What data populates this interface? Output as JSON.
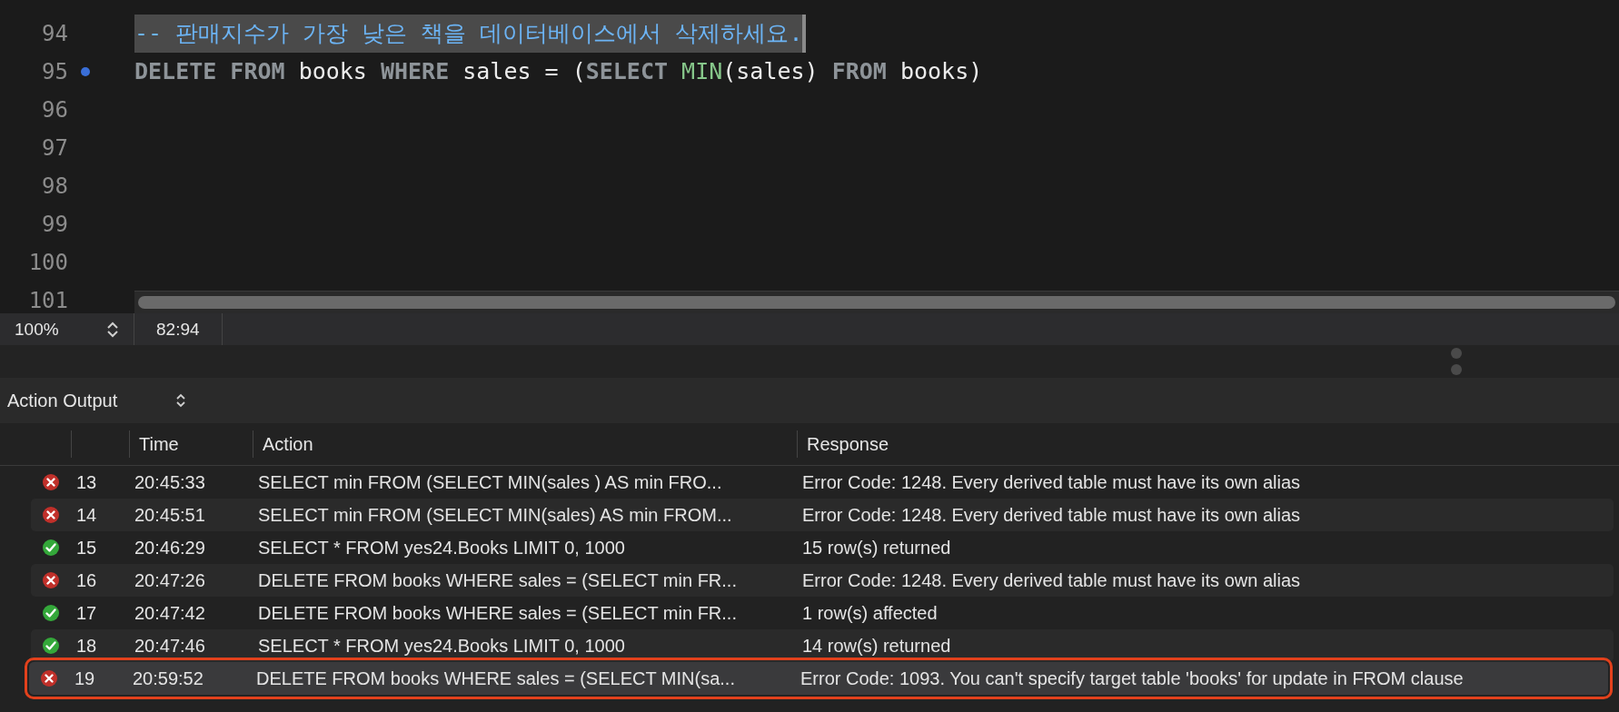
{
  "editor": {
    "lines": [
      {
        "number": "94",
        "highlighted": true,
        "marker": false,
        "tokens": [
          {
            "kind": "comment",
            "text": "-- 판매지수가 가장 낮은 책을 데이터베이스에서 삭제하세요."
          }
        ]
      },
      {
        "number": "95",
        "highlighted": false,
        "marker": true,
        "tokens": [
          {
            "kind": "keyword",
            "text": "DELETE FROM"
          },
          {
            "kind": "ident",
            "text": " books "
          },
          {
            "kind": "keyword",
            "text": "WHERE"
          },
          {
            "kind": "ident",
            "text": " sales = ("
          },
          {
            "kind": "keyword",
            "text": "SELECT "
          },
          {
            "kind": "function",
            "text": "MIN"
          },
          {
            "kind": "ident",
            "text": "(sales) "
          },
          {
            "kind": "keyword",
            "text": "FROM"
          },
          {
            "kind": "ident",
            "text": " books)"
          }
        ]
      },
      {
        "number": "96",
        "highlighted": false,
        "marker": false
      },
      {
        "number": "97",
        "highlighted": false,
        "marker": false
      },
      {
        "number": "98",
        "highlighted": false,
        "marker": false
      },
      {
        "number": "99",
        "highlighted": false,
        "marker": false
      },
      {
        "number": "100",
        "highlighted": false,
        "marker": false
      },
      {
        "number": "101",
        "highlighted": false,
        "marker": false
      }
    ]
  },
  "status_bar": {
    "zoom": "100%",
    "position": "82:94"
  },
  "output": {
    "title": "Action Output",
    "columns": [
      "Time",
      "Action",
      "Response"
    ],
    "rows": [
      {
        "kind": "error",
        "index": "13",
        "time": "20:45:33",
        "action": "SELECT min FROM (SELECT MIN(sales ) AS min FRO...",
        "response": "Error Code: 1248. Every derived table must have its own alias",
        "selected": false
      },
      {
        "kind": "error",
        "index": "14",
        "time": "20:45:51",
        "action": "SELECT min FROM (SELECT MIN(sales) AS min FROM...",
        "response": "Error Code: 1248. Every derived table must have its own alias",
        "selected": false
      },
      {
        "kind": "success",
        "index": "15",
        "time": "20:46:29",
        "action": "SELECT * FROM yes24.Books LIMIT 0, 1000",
        "response": "15 row(s) returned",
        "selected": false
      },
      {
        "kind": "error",
        "index": "16",
        "time": "20:47:26",
        "action": "DELETE FROM books WHERE sales = (SELECT min FR...",
        "response": "Error Code: 1248. Every derived table must have its own alias",
        "selected": false
      },
      {
        "kind": "success",
        "index": "17",
        "time": "20:47:42",
        "action": "DELETE FROM books WHERE sales = (SELECT min FR...",
        "response": "1 row(s) affected",
        "selected": false
      },
      {
        "kind": "success",
        "index": "18",
        "time": "20:47:46",
        "action": "SELECT * FROM yes24.Books LIMIT 0, 1000",
        "response": "14 row(s) returned",
        "selected": false
      },
      {
        "kind": "error",
        "index": "19",
        "time": "20:59:52",
        "action": "DELETE FROM books WHERE sales = (SELECT MIN(sa...",
        "response": "Error Code: 1093. You can't specify target table 'books' for update in FROM clause",
        "selected": true
      }
    ]
  }
}
